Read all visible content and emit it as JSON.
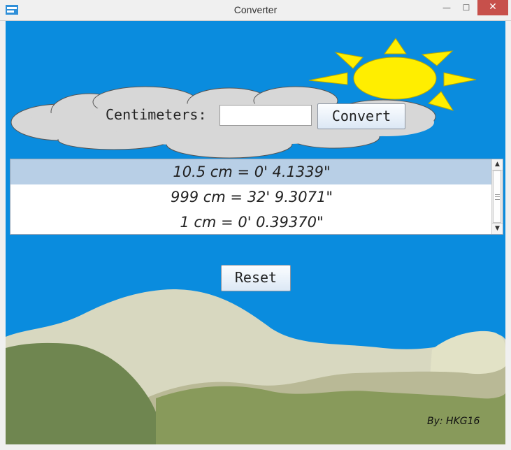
{
  "window": {
    "title": "Converter",
    "minimize_glyph": "—",
    "maximize_glyph": "☐",
    "close_glyph": "✕"
  },
  "form": {
    "label": "Centimeters:",
    "input_value": "",
    "convert_label": "Convert",
    "reset_label": "Reset"
  },
  "results": {
    "items": [
      {
        "text": "10.5 cm = 0' 4.1339\"",
        "selected": true
      },
      {
        "text": "999 cm = 32' 9.3071\"",
        "selected": false
      },
      {
        "text": "1 cm = 0' 0.39370\"",
        "selected": false
      }
    ],
    "scroll_up_glyph": "▲",
    "scroll_down_glyph": "▼"
  },
  "credit": "By: HKG16",
  "colors": {
    "sky": "#0a8cde",
    "sun": "#ffee00",
    "cloud": "#d7d7d7",
    "hill_light": "#d8d8c0",
    "hill_green": "#7c8f55",
    "close_button": "#c7504b"
  },
  "icons": {
    "app": "converter-app-icon",
    "sun": "sun-illustration",
    "cloud": "cloud-illustration"
  }
}
